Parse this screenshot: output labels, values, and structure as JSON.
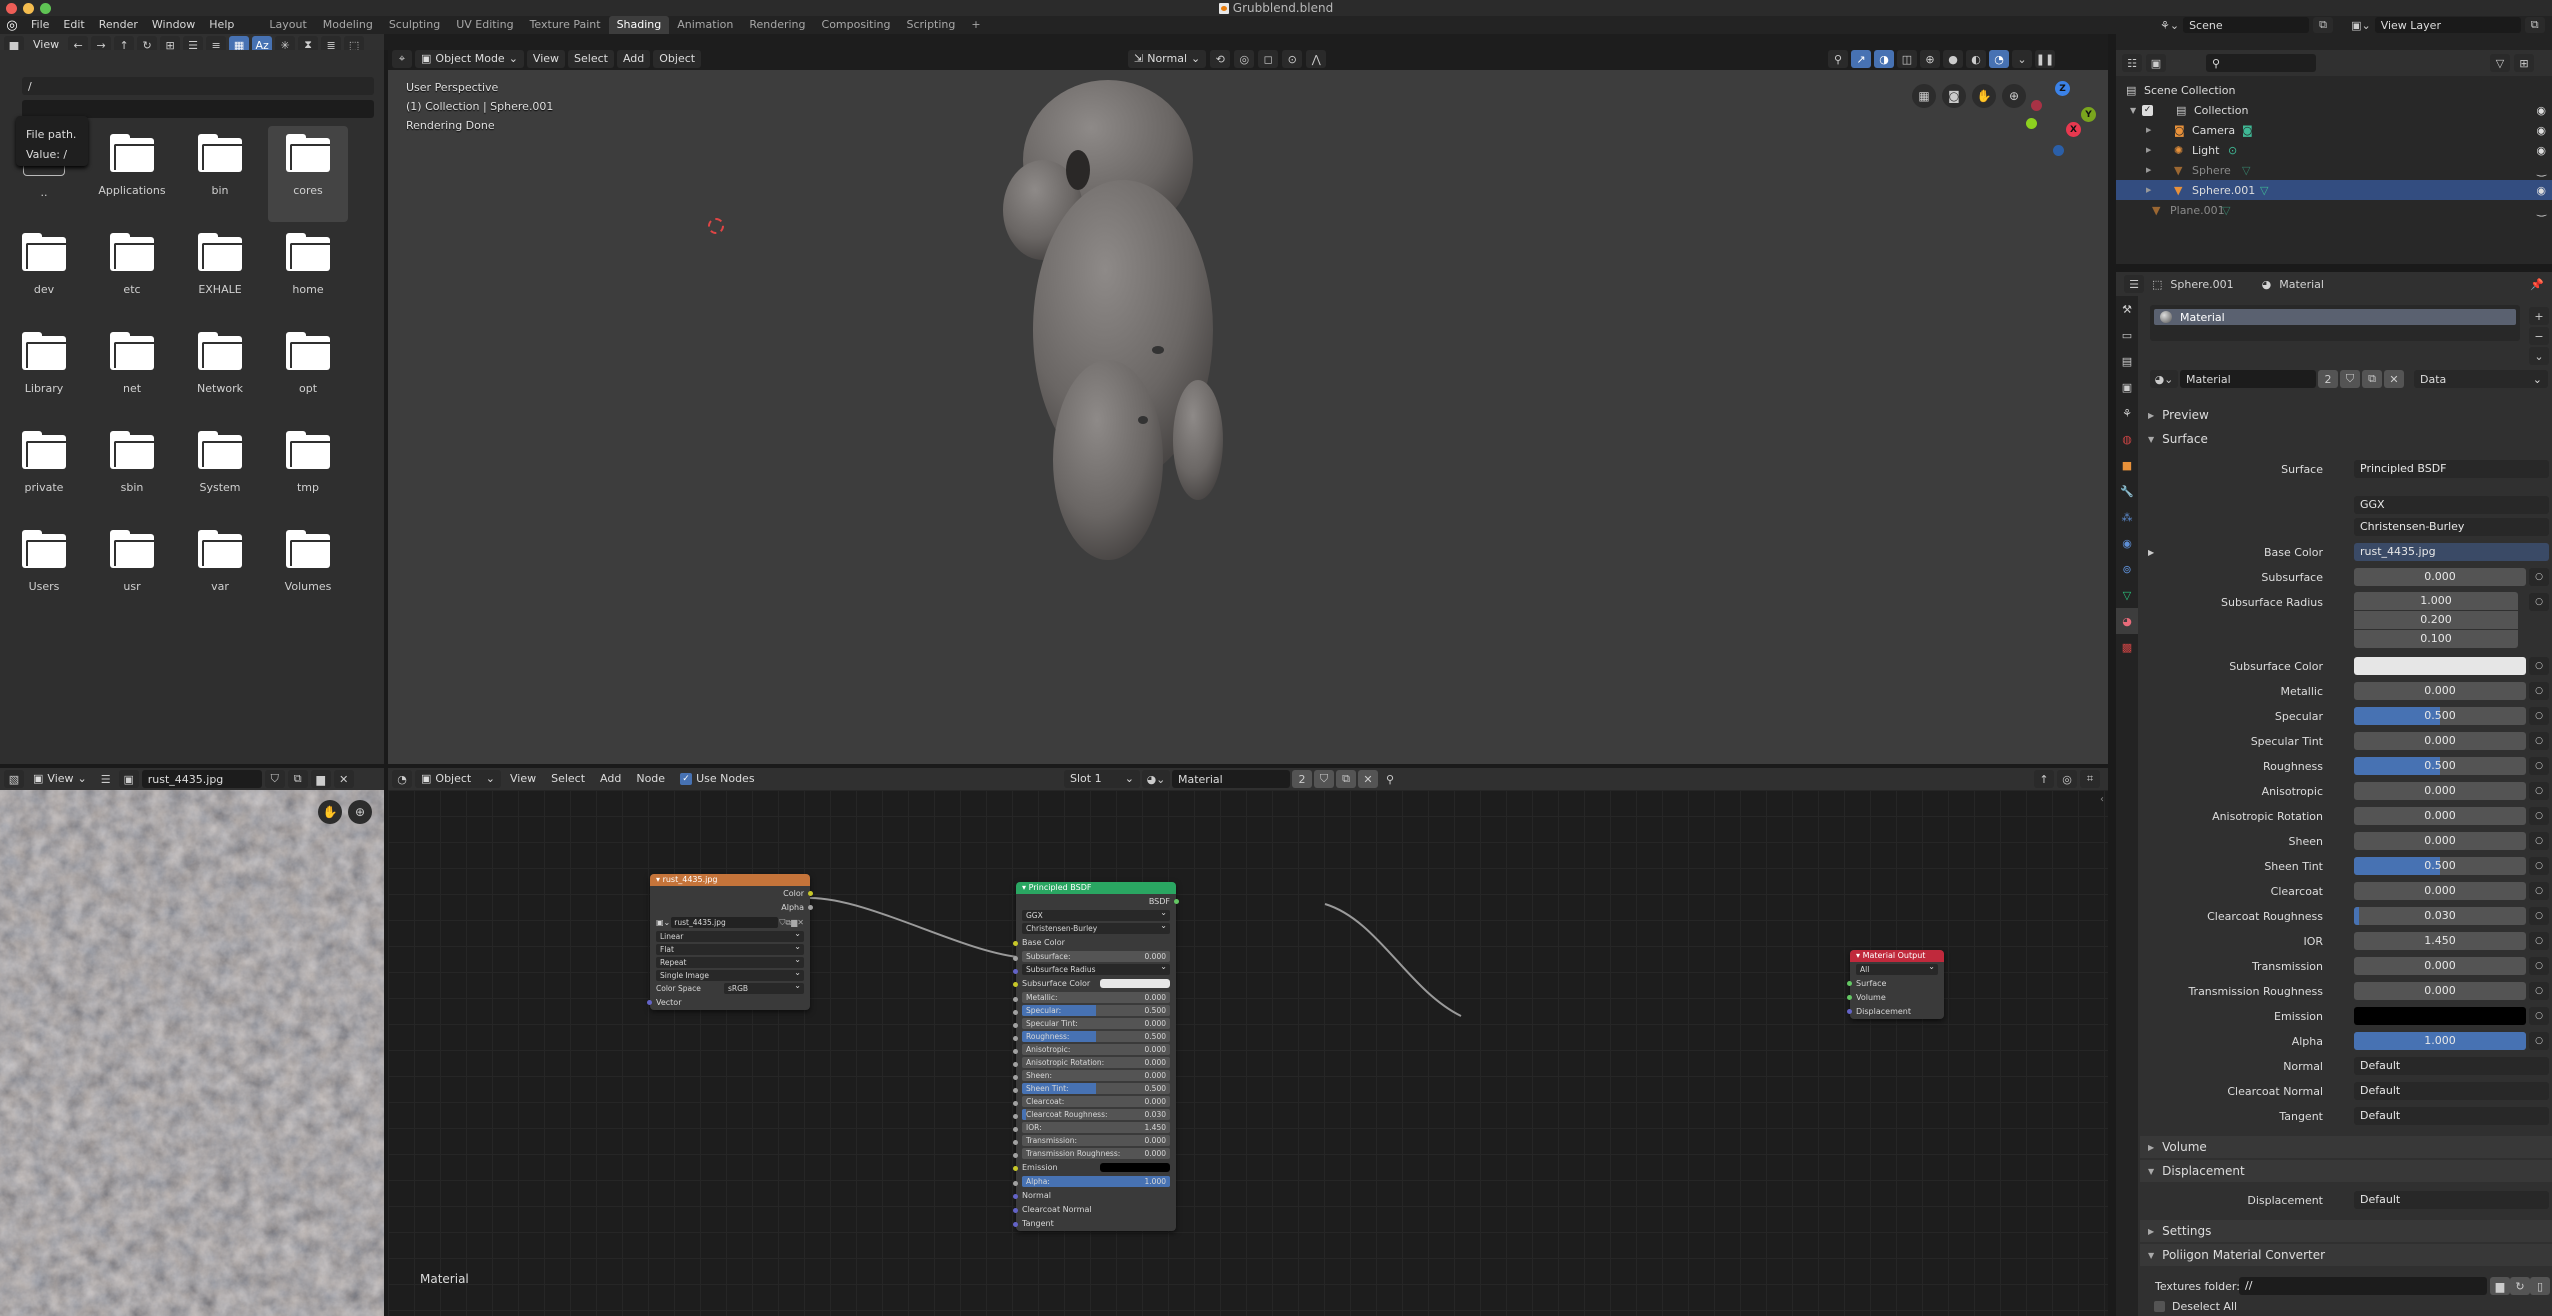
{
  "window": {
    "title": "Grubblend.blend",
    "traffic_colors": [
      "#ee5e57",
      "#f5bd4f",
      "#5fc454"
    ]
  },
  "menu": {
    "items": [
      "File",
      "Edit",
      "Render",
      "Window",
      "Help"
    ]
  },
  "workspaces": {
    "tabs": [
      "Layout",
      "Modeling",
      "Sculpting",
      "UV Editing",
      "Texture Paint",
      "Shading",
      "Animation",
      "Rendering",
      "Compositing",
      "Scripting"
    ],
    "active": "Shading",
    "add": "+"
  },
  "scene": {
    "name": "Scene",
    "view_layer": "View Layer"
  },
  "filebrowser": {
    "view_label": "View",
    "path": "/",
    "filename": "",
    "tooltip": {
      "title": "File path.",
      "value": "Value: /"
    },
    "parent_label": "..",
    "items": [
      "Applications",
      "bin",
      "cores",
      "dev",
      "etc",
      "EXHALE",
      "home",
      "Library",
      "net",
      "Network",
      "opt",
      "private",
      "sbin",
      "System",
      "tmp",
      "Users",
      "usr",
      "var",
      "Volumes"
    ],
    "selected": "cores"
  },
  "viewport": {
    "mode": "Object Mode",
    "menus": [
      "View",
      "Select",
      "Add",
      "Object"
    ],
    "orientation": "Normal",
    "overlay_lines": [
      "User Perspective",
      "(1) Collection | Sphere.001",
      "Rendering Done"
    ],
    "gizmo": {
      "z": "Z",
      "y": "Y",
      "x": "X"
    }
  },
  "outliner": {
    "search_placeholder": "",
    "rows": [
      {
        "label": "Scene Collection",
        "type": "scene-collection",
        "visible": null
      },
      {
        "label": "Collection",
        "type": "collection",
        "visible": true
      },
      {
        "label": "Camera",
        "type": "camera",
        "visible": true
      },
      {
        "label": "Light",
        "type": "light",
        "visible": true
      },
      {
        "label": "Sphere",
        "type": "mesh",
        "visible": false,
        "dim": true
      },
      {
        "label": "Sphere.001",
        "type": "mesh",
        "visible": true,
        "selected": true
      },
      {
        "label": "Plane.001",
        "type": "mesh",
        "visible": false,
        "dim": true
      }
    ]
  },
  "properties": {
    "breadcrumb": {
      "object": "Sphere.001",
      "material": "Material"
    },
    "slot_list": [
      "Material"
    ],
    "material_name": "Material",
    "users": "2",
    "link": "Data",
    "sections": {
      "preview": "Preview",
      "surface": "Surface",
      "volume": "Volume",
      "displacement": "Displacement",
      "settings": "Settings",
      "converter": "Poliigon Material Converter"
    },
    "surface": {
      "label": "Surface",
      "value": "Principled BSDF"
    },
    "distribution": "GGX",
    "subsurface_method": "Christensen-Burley",
    "base_color": {
      "label": "Base Color",
      "value": "rust_4435.jpg"
    },
    "inputs": [
      {
        "label": "Subsurface",
        "value": "0.000",
        "fraction": 0
      },
      {
        "label": "Metallic",
        "value": "0.000",
        "fraction": 0
      },
      {
        "label": "Specular",
        "value": "0.500",
        "fraction": 0.5
      },
      {
        "label": "Specular Tint",
        "value": "0.000",
        "fraction": 0
      },
      {
        "label": "Roughness",
        "value": "0.500",
        "fraction": 0.5
      },
      {
        "label": "Anisotropic",
        "value": "0.000",
        "fraction": 0
      },
      {
        "label": "Anisotropic Rotation",
        "value": "0.000",
        "fraction": 0
      },
      {
        "label": "Sheen",
        "value": "0.000",
        "fraction": 0
      },
      {
        "label": "Sheen Tint",
        "value": "0.500",
        "fraction": 0.5
      },
      {
        "label": "Clearcoat",
        "value": "0.000",
        "fraction": 0
      },
      {
        "label": "Clearcoat Roughness",
        "value": "0.030",
        "fraction": 0.03
      },
      {
        "label": "IOR",
        "value": "1.450",
        "fraction": 0
      },
      {
        "label": "Transmission",
        "value": "0.000",
        "fraction": 0
      },
      {
        "label": "Transmission Roughness",
        "value": "0.000",
        "fraction": 0
      }
    ],
    "subsurface_radius": {
      "label": "Subsurface Radius",
      "values": [
        "1.000",
        "0.200",
        "0.100"
      ]
    },
    "subsurface_color": {
      "label": "Subsurface Color",
      "color": "#e6e6e6"
    },
    "emission": {
      "label": "Emission",
      "color": "#000000"
    },
    "alpha": {
      "label": "Alpha",
      "value": "1.000",
      "fraction": 1
    },
    "vectors": [
      {
        "label": "Normal",
        "value": "Default"
      },
      {
        "label": "Clearcoat Normal",
        "value": "Default"
      },
      {
        "label": "Tangent",
        "value": "Default"
      }
    ],
    "displacement": {
      "label": "Displacement",
      "value": "Default"
    },
    "textures_folder": {
      "label": "Textures folder:",
      "value": "//"
    },
    "deselect_all": "Deselect All"
  },
  "imageeditor": {
    "view_label": "View",
    "image_name": "rust_4435.jpg"
  },
  "nodeeditor": {
    "object_label": "Object",
    "menus": [
      "View",
      "Select",
      "Add",
      "Node"
    ],
    "use_nodes": "Use Nodes",
    "slot": "Slot 1",
    "material": "Material",
    "users": "2",
    "footer_label": "Material",
    "image_node": {
      "title": "rust_4435.jpg",
      "outputs": [
        "Color",
        "Alpha"
      ],
      "image": "rust_4435.jpg",
      "interpolation": "Linear",
      "projection": "Flat",
      "extension": "Repeat",
      "source": "Single Image",
      "color_space_label": "Color Space",
      "color_space": "sRGB",
      "input": "Vector"
    },
    "bsdf_node": {
      "title": "Principled BSDF",
      "output": "BSDF",
      "distribution": "GGX",
      "subsurface_method": "Christensen-Burley",
      "rows": [
        {
          "label": "Base Color",
          "type": "socket"
        },
        {
          "label": "Subsurface:",
          "value": "0.000",
          "fraction": 0
        },
        {
          "label": "Subsurface Radius",
          "type": "select"
        },
        {
          "label": "Subsurface Color",
          "type": "color",
          "color": "#e6e6e6"
        },
        {
          "label": "Metallic:",
          "value": "0.000",
          "fraction": 0
        },
        {
          "label": "Specular:",
          "value": "0.500",
          "fraction": 0.5
        },
        {
          "label": "Specular Tint:",
          "value": "0.000",
          "fraction": 0
        },
        {
          "label": "Roughness:",
          "value": "0.500",
          "fraction": 0.5
        },
        {
          "label": "Anisotropic:",
          "value": "0.000",
          "fraction": 0
        },
        {
          "label": "Anisotropic Rotation:",
          "value": "0.000",
          "fraction": 0
        },
        {
          "label": "Sheen:",
          "value": "0.000",
          "fraction": 0
        },
        {
          "label": "Sheen Tint:",
          "value": "0.500",
          "fraction": 0.5
        },
        {
          "label": "Clearcoat:",
          "value": "0.000",
          "fraction": 0
        },
        {
          "label": "Clearcoat Roughness:",
          "value": "0.030",
          "fraction": 0.03
        },
        {
          "label": "IOR:",
          "value": "1.450",
          "fraction": 0
        },
        {
          "label": "Transmission:",
          "value": "0.000",
          "fraction": 0
        },
        {
          "label": "Transmission Roughness:",
          "value": "0.000",
          "fraction": 0
        },
        {
          "label": "Emission",
          "type": "color",
          "color": "#000000"
        },
        {
          "label": "Alpha:",
          "value": "1.000",
          "fraction": 1
        },
        {
          "label": "Normal",
          "type": "socket"
        },
        {
          "label": "Clearcoat Normal",
          "type": "socket"
        },
        {
          "label": "Tangent",
          "type": "socket"
        }
      ]
    },
    "output_node": {
      "title": "Material Output",
      "target": "All",
      "inputs": [
        "Surface",
        "Volume",
        "Displacement"
      ]
    }
  },
  "colors": {
    "accent": "#4772b3",
    "image_node": "#c5743a",
    "bsdf_node": "#2aa662",
    "output_node": "#c0293c",
    "selected_row": "#334d80"
  }
}
